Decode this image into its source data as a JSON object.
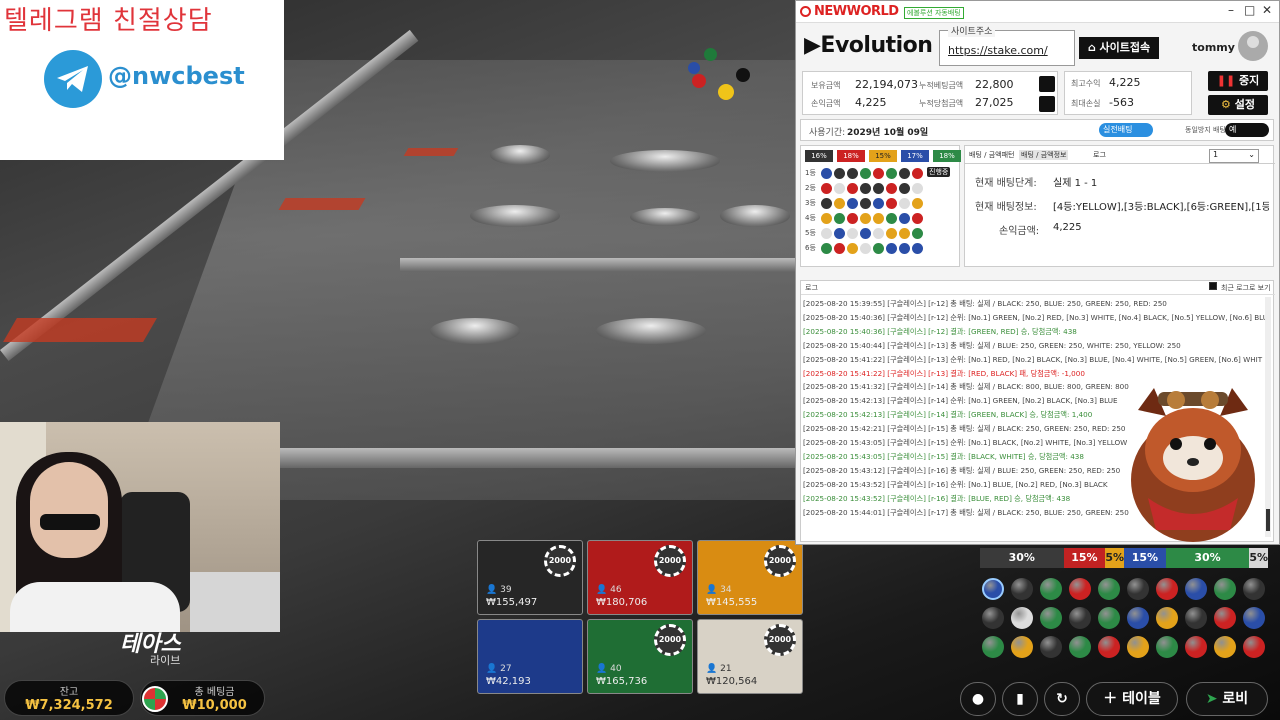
{
  "telegram": {
    "title": "텔레그램 친절상담",
    "handle": "@nwcbest"
  },
  "stream": {
    "logo": "테아스",
    "logo_sub": "라이브"
  },
  "balance": {
    "label": "잔고",
    "value": "₩7,324,572"
  },
  "total_bet": {
    "label": "총 베팅금",
    "value": "₩10,000"
  },
  "bets": [
    {
      "color": "#262626",
      "chip": "2000",
      "count": "39",
      "amount": "₩155,497"
    },
    {
      "color": "#b01b1b",
      "chip": "2000",
      "count": "46",
      "amount": "₩180,706"
    },
    {
      "color": "#d98c12",
      "chip": "2000",
      "count": "34",
      "amount": "₩145,555"
    },
    {
      "color": "#1d3a8a",
      "chip": "",
      "count": "27",
      "amount": "₩42,193"
    },
    {
      "color": "#1f6e34",
      "chip": "2000",
      "count": "40",
      "amount": "₩165,736"
    },
    {
      "color": "#d8d2c6",
      "chip": "2000",
      "count": "21",
      "amount": "₩120,564"
    }
  ],
  "stat_bar": [
    {
      "label": "30%",
      "color": "#3a3a3a",
      "share": 30
    },
    {
      "label": "15%",
      "color": "#c22222",
      "share": 15
    },
    {
      "label": "5%",
      "color": "#e3a21a",
      "share": 5
    },
    {
      "label": "15%",
      "color": "#2a4ea8",
      "share": 15
    },
    {
      "label": "30%",
      "color": "#2d8a46",
      "share": 30
    },
    {
      "label": "5%",
      "color": "#d8d8d8",
      "share": 5
    }
  ],
  "nav": {
    "table_label": "테이블",
    "lobby_label": "로비"
  },
  "window": {
    "brand": "NEWWORLD",
    "brand_sub": "에볼루션 자동배팅",
    "provider": "Evolution",
    "site_label": "사이트주소",
    "site_url": "https://stake.com/",
    "site_button": "사이트접속",
    "user": "tommy",
    "stats": {
      "hold_label": "보유금액",
      "hold": "22,194,073",
      "cum_bet_label": "누적베팅금액",
      "cum_bet": "22,800",
      "profit_label": "손익금액",
      "profit": "4,225",
      "cum_win_label": "누적당첨금액",
      "cum_win": "27,025",
      "max_profit_label": "최고수익",
      "max_profit": "4,225",
      "max_loss_label": "최대손실",
      "max_loss": "-563"
    },
    "stop_label": "중지",
    "settings_label": "설정",
    "period_label": "사용기간:",
    "period_value": "2029년 10월 09일",
    "live_toggle": "실전배팅",
    "block_label": "동일방지 배팅:",
    "block_value": "예",
    "board": {
      "percents": [
        {
          "label": "16%",
          "color": "#333"
        },
        {
          "label": "18%",
          "color": "#c22"
        },
        {
          "label": "15%",
          "color": "#e3a21a"
        },
        {
          "label": "17%",
          "color": "#2a4ea8"
        },
        {
          "label": "18%",
          "color": "#2d8a46"
        }
      ],
      "ranks": [
        "1등",
        "2등",
        "3등",
        "4등",
        "5등",
        "6등"
      ],
      "live_badge": "진행중",
      "rows": [
        [
          "#2a4ea8",
          "#333",
          "#333",
          "#2d8a46",
          "#c22",
          "#2d8a46",
          "#333",
          "#c22"
        ],
        [
          "#c22",
          "#ddd",
          "#c22",
          "#333",
          "#333",
          "#c22",
          "#333",
          "#ddd"
        ],
        [
          "#333",
          "#e3a21a",
          "#2a4ea8",
          "#333",
          "#2a4ea8",
          "#c22",
          "#ddd",
          "#e3a21a"
        ],
        [
          "#e3a21a",
          "#2d8a46",
          "#c22",
          "#e3a21a",
          "#e3a21a",
          "#2d8a46",
          "#2a4ea8",
          "#c22"
        ],
        [
          "#ddd",
          "#2a4ea8",
          "#ddd",
          "#2a4ea8",
          "#ddd",
          "#e3a21a",
          "#e3a21a",
          "#2d8a46"
        ],
        [
          "#2d8a46",
          "#c22",
          "#e3a21a",
          "#ddd",
          "#2d8a46",
          "#2a4ea8",
          "#2a4ea8",
          "#2a4ea8"
        ]
      ]
    },
    "tabs": [
      "배팅 / 금액패턴",
      "배팅 / 금액정보",
      "로그"
    ],
    "select_value": "1",
    "info": {
      "stage_label": "현재 배팅단계:",
      "stage": "실제 1 - 1",
      "bet_label": "현재 배팅정보:",
      "bet": "[4등:YELLOW],[3등:BLACK],[6등:GREEN],[1등",
      "profit_label": "손익금액:",
      "profit": "4,225"
    },
    "log_label": "로그",
    "log_recent": "최근 로그로 보기",
    "log_lines": [
      {
        "c": "c-w",
        "t": "[2025-08-20 15:39:55] [구슬레이스] [r-12] 총 배팅: 실제 / BLACK: 250, BLUE: 250, GREEN: 250, RED: 250"
      },
      {
        "c": "c-w",
        "t": "[2025-08-20 15:40:36] [구슬레이스] [r-12] 순위: [No.1] GREEN, [No.2] RED, [No.3] WHITE, [No.4] BLACK, [No.5] YELLOW, [No.6] BLU"
      },
      {
        "c": "c-g",
        "t": "[2025-08-20 15:40:36] [구슬레이스] [r-12] 결과: [GREEN, RED] 승, 당첨금액: 438"
      },
      {
        "c": "c-w",
        "t": "[2025-08-20 15:40:44] [구슬레이스] [r-13] 총 배팅: 실제 / BLUE: 250, GREEN: 250, WHITE: 250, YELLOW: 250"
      },
      {
        "c": "c-w",
        "t": "[2025-08-20 15:41:22] [구슬레이스] [r-13] 순위: [No.1] RED, [No.2] BLACK, [No.3] BLUE, [No.4] WHITE, [No.5] GREEN, [No.6] WHIT"
      },
      {
        "c": "c-r",
        "t": "[2025-08-20 15:41:22] [구슬레이스] [r-13] 결과: [RED, BLACK] 패, 당첨금액: -1,000"
      },
      {
        "c": "c-w",
        "t": "[2025-08-20 15:41:32] [구슬레이스] [r-14] 총 배팅: 실제 / BLACK: 800, BLUE: 800, GREEN: 800"
      },
      {
        "c": "c-w",
        "t": "[2025-08-20 15:42:13] [구슬레이스] [r-14] 순위: [No.1] GREEN, [No.2] BLACK, [No.3] BLUE"
      },
      {
        "c": "c-g",
        "t": "[2025-08-20 15:42:13] [구슬레이스] [r-14] 결과: [GREEN, BLACK] 승, 당첨금액: 1,400"
      },
      {
        "c": "c-w",
        "t": "[2025-08-20 15:42:21] [구슬레이스] [r-15] 총 배팅: 실제 / BLACK: 250, GREEN: 250, RED: 250"
      },
      {
        "c": "c-w",
        "t": "[2025-08-20 15:43:05] [구슬레이스] [r-15] 순위: [No.1] BLACK, [No.2] WHITE, [No.3] YELLOW"
      },
      {
        "c": "c-g",
        "t": "[2025-08-20 15:43:05] [구슬레이스] [r-15] 결과: [BLACK, WHITE] 승, 당첨금액: 438"
      },
      {
        "c": "c-w",
        "t": "[2025-08-20 15:43:12] [구슬레이스] [r-16] 총 배팅: 실제 / BLUE: 250, GREEN: 250, RED: 250"
      },
      {
        "c": "c-w",
        "t": "[2025-08-20 15:43:52] [구슬레이스] [r-16] 순위: [No.1] BLUE, [No.2] RED, [No.3] BLACK"
      },
      {
        "c": "c-g",
        "t": "[2025-08-20 15:43:52] [구슬레이스] [r-16] 결과: [BLUE, RED] 승, 당첨금액: 438"
      },
      {
        "c": "c-w",
        "t": "[2025-08-20 15:44:01] [구슬레이스] [r-17] 총 배팅: 실제 / BLACK: 250, BLUE: 250, GREEN: 250"
      }
    ]
  },
  "ball_grid": [
    [
      "#2a4ea8",
      "#333",
      "#2d8a46",
      "#c22",
      "#2d8a46",
      "#333",
      "#c22",
      "#2a4ea8",
      "#2d8a46",
      "#333"
    ],
    [
      "#333",
      "#ddd",
      "#2d8a46",
      "#333",
      "#2d8a46",
      "#2a4ea8",
      "#e3a21a",
      "#333",
      "#c22",
      "#2a4ea8"
    ],
    [
      "#2d8a46",
      "#e3a21a",
      "#333",
      "#2d8a46",
      "#c22",
      "#e3a21a",
      "#2d8a46",
      "#c22",
      "#e3a21a",
      "#c22"
    ]
  ]
}
